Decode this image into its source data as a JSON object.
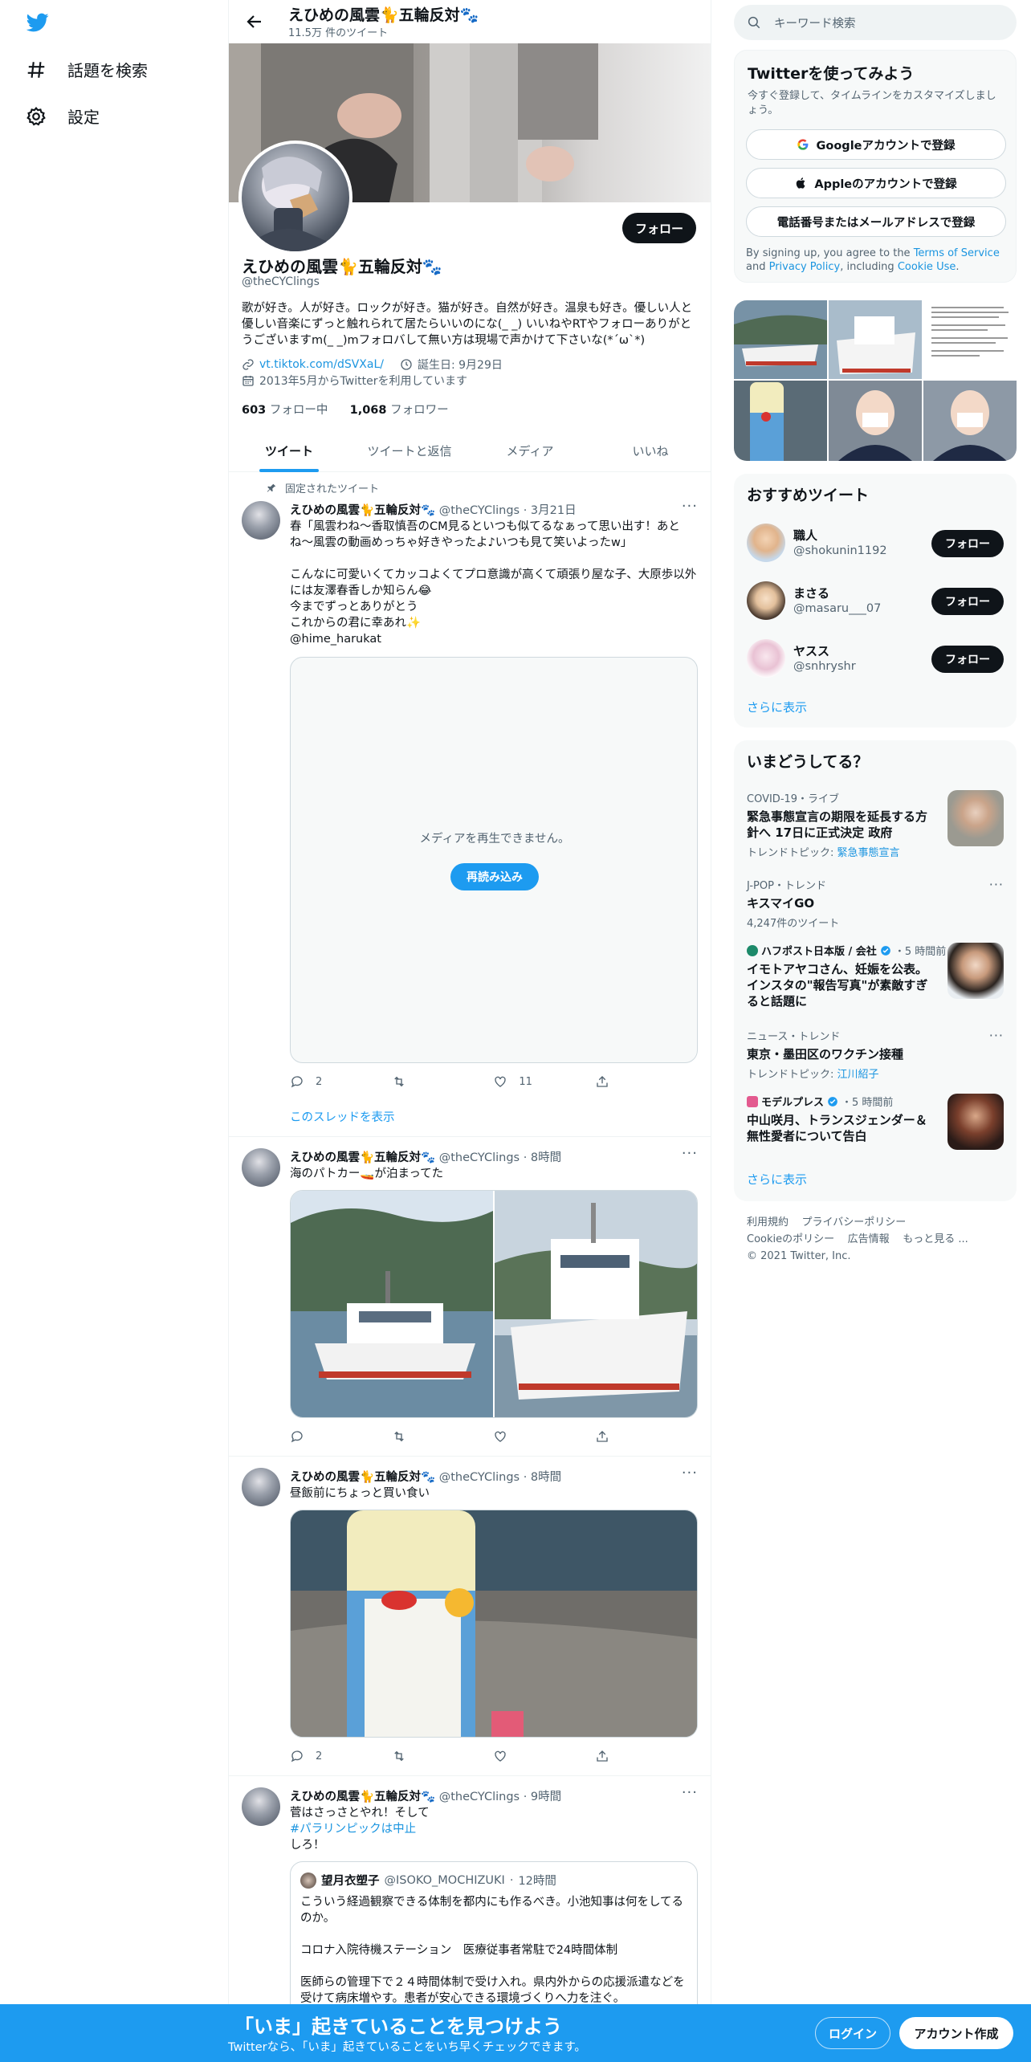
{
  "nav": {
    "items": [
      {
        "label": "話題を検索",
        "icon": "hashtag-icon"
      },
      {
        "label": "設定",
        "icon": "gear-icon"
      }
    ]
  },
  "topbar": {
    "title": "えひめの風雲🐈五輪反対🐾",
    "tweet_count": "11.5万 件のツイート"
  },
  "profile": {
    "name": "えひめの風雲🐈五輪反対🐾",
    "handle": "@theCYClings",
    "follow_label": "フォロー",
    "bio": "歌が好き。人が好き。ロックが好き。猫が好き。自然が好き。温泉も好き。優しい人と優しい音楽にずっと触れられて居たらいいのにな(_ _) いいねやRTやフォローありがとうございますm(_ _)mフォロバして無い方は現場で声かけて下さいな(*´ω`*)",
    "link": "vt.tiktok.com/dSVXaL/",
    "birthday": "誕生日: 9月29日",
    "joined": "2013年5月からTwitterを利用しています",
    "following_count": "603",
    "following_label": "フォロー中",
    "followers_count": "1,068",
    "followers_label": "フォロワー"
  },
  "tabs": [
    "ツイート",
    "ツイートと返信",
    "メディア",
    "いいね"
  ],
  "tweets": [
    {
      "pinned_label": "固定されたツイート",
      "name": "えひめの風雲🐈五輪反対🐾",
      "handle": "@theCYClings",
      "time": "3月21日",
      "text": "春「風雲わね〜香取慎吾のCM見るといつも似てるなぁって思い出す！あとね〜風雲の動画めっちゃ好きやったよ♪いつも見て笑いよったw」\n\nこんなに可愛いくてカッコよくてプロ意識が高くて頑張り屋な子、大原歩以外には友澤春香しか知らん😂\n今までずっとありがとう\nこれからの君に幸あれ✨\n@hime_harukat",
      "media_error": "メディアを再生できません。",
      "reload_label": "再読み込み",
      "replies": "2",
      "retweets": "",
      "likes": "11",
      "thread_link": "このスレッドを表示"
    },
    {
      "name": "えひめの風雲🐈五輪反対🐾",
      "handle": "@theCYClings",
      "time": "8時間",
      "text": "海のパトカー🚤が泊まってた",
      "replies": "",
      "retweets": "",
      "likes": ""
    },
    {
      "name": "えひめの風雲🐈五輪反対🐾",
      "handle": "@theCYClings",
      "time": "8時間",
      "text": "昼飯前にちょっと買い食い",
      "replies": "2",
      "retweets": "",
      "likes": ""
    },
    {
      "name": "えひめの風雲🐈五輪反対🐾",
      "handle": "@theCYClings",
      "time": "9時間",
      "text_line1": "菅はさっさとやれ！そして",
      "hashtag": "#パラリンピックは中止",
      "text_line3": "しろ！",
      "quote": {
        "name": "望月衣塑子",
        "handle": "@ISOKO_MOCHIZUKI",
        "time": "12時間",
        "text": "こういう経過観察できる体制を都内にも作るべき。小池知事は何をしてるのか。\n\nコロナ入院待機ステーション　医療従事者常駐で24時間体制\n\n医師らの管理下で２４時間体制で受け入れ。県内外からの応援派遣などを受けて病床増やす。患者が安心できる環境づくりへ力を注ぐ。"
      }
    }
  ],
  "sidebar": {
    "search_placeholder": "キーワード検索",
    "join": {
      "title": "Twitterを使ってみよう",
      "subtitle": "今すぐ登録して、タイムラインをカスタマイズしましょう。",
      "google": "Googleアカウントで登録",
      "apple": "Appleのアカウントで登録",
      "phone": "電話番号またはメールアドレスで登録",
      "terms_prefix": "By signing up, you agree to the ",
      "terms": "Terms of Service",
      "and": " and ",
      "privacy": "Privacy Policy",
      "including": ", including ",
      "cookie": "Cookie Use",
      "period": "."
    },
    "recommended": {
      "title": "おすすめツイート",
      "users": [
        {
          "name": "職人",
          "handle": "@shokunin1192",
          "button": "フォロー"
        },
        {
          "name": "まさる",
          "handle": "@masaru___07",
          "button": "フォロー"
        },
        {
          "name": "ヤスス",
          "handle": "@snhryshr",
          "button": "フォロー"
        }
      ],
      "show_more": "さらに表示"
    },
    "trends": {
      "title": "いまどうしてる？",
      "items": [
        {
          "meta": "COVID-19・ライブ",
          "title": "緊急事態宣言の期限を延長する方針へ 17日に正式決定 政府",
          "sub_label": "トレンドトピック: ",
          "sub_link": "緊急事態宣言"
        },
        {
          "meta": "J-POP・トレンド",
          "title": "キスマイGO",
          "sub": "4,247件のツイート"
        },
        {
          "meta_source": "ハフポスト日本版 / 会社",
          "meta_time": "・5 時間前",
          "title": "イモトアヤコさん、妊娠を公表。インスタの\"報告写真\"が素敵すぎると話題に"
        },
        {
          "meta": "ニュース・トレンド",
          "title": "東京・墨田区のワクチン接種",
          "sub_label": "トレンドトピック: ",
          "sub_link": "江川紹子"
        },
        {
          "meta_source": "モデルプレス",
          "meta_time": "・5 時間前",
          "title": "中山咲月、トランスジェンダー＆無性愛者について告白"
        }
      ],
      "show_more": "さらに表示"
    },
    "footer": {
      "terms": "利用規約",
      "privacy": "プライバシーポリシー",
      "cookie": "Cookieのポリシー",
      "ads": "広告情報",
      "more": "もっと見る ...",
      "copyright": "© 2021 Twitter, Inc."
    }
  },
  "bottombar": {
    "title": "「いま」起きていることを見つけよう",
    "subtitle": "Twitterなら、「いま」起きていることをいち早くチェックできます。",
    "login": "ログイン",
    "signup": "アカウント作成"
  },
  "colors": {
    "accent": "#1d9bf0",
    "text": "#0f1419",
    "muted": "#536471",
    "bottombar": "#1d9bf0"
  }
}
